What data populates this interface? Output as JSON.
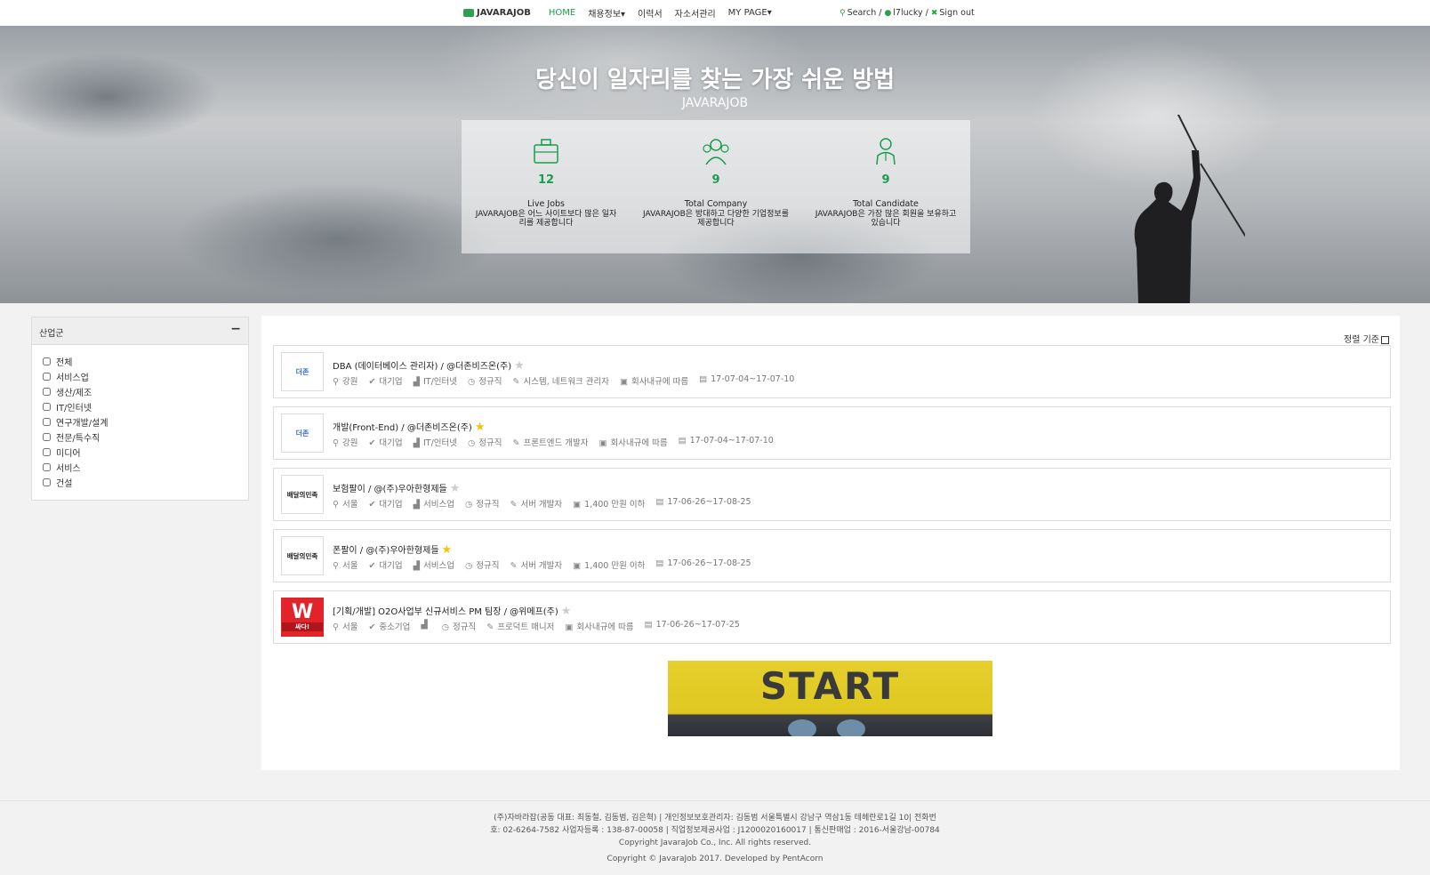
{
  "nav": {
    "logo": "JAVARAJOB",
    "items": [
      {
        "label": "HOME"
      },
      {
        "label": "채용정보▾"
      },
      {
        "label": "이력서"
      },
      {
        "label": "자소서관리"
      },
      {
        "label": "MY PAGE▾"
      }
    ],
    "search": "Search",
    "user": "l7lucky",
    "signout": "Sign out",
    "accent": "#1a9d4c"
  },
  "hero": {
    "title": "당신이 일자리를 찾는 가장 쉬운 방법",
    "subtitle": "JAVARAJOB",
    "stats": [
      {
        "value": "12",
        "label": "Live Jobs",
        "desc": "JAVARAJOB은 어느 사이트보다 많은 일자리를 제공합니다",
        "icon": "briefcase-icon"
      },
      {
        "value": "9",
        "label": "Total Company",
        "desc": "JAVARAJOB은 방대하고 다양한 기업정보를 제공합니다",
        "icon": "company-group-icon"
      },
      {
        "value": "9",
        "label": "Total Candidate",
        "desc": "JAVARAJOB은 가장 많은 회원을 보유하고 있습니다",
        "icon": "candidate-icon"
      }
    ]
  },
  "sidebar": {
    "title": "산업군",
    "toggle": "−",
    "filters": [
      "전체",
      "서비스업",
      "생산/제조",
      "IT/인터넷",
      "연구개발/설계",
      "전문/특수직",
      "미디어",
      "서비스",
      "건설"
    ]
  },
  "main": {
    "sort_label": "정렬 기준",
    "jobs": [
      {
        "title": "DBA (데이터베이스 관리자) / @더존비즈온(주)",
        "starred": false,
        "logo": "더존",
        "location": "강원",
        "size": "대기업",
        "industry": "IT/인터넷",
        "type": "정규직",
        "role": "시스템, 네트워크 관리자",
        "salary": "회사내규에 따름",
        "period": "17-07-04~17-07-10"
      },
      {
        "title": "개발(Front-End) / @더존비즈온(주)",
        "starred": true,
        "logo": "더존",
        "location": "강원",
        "size": "대기업",
        "industry": "IT/인터넷",
        "type": "정규직",
        "role": "프론트엔드 개발자",
        "salary": "회사내규에 따름",
        "period": "17-07-04~17-07-10"
      },
      {
        "title": "보험팔이 / @(주)우아한형제들",
        "starred": false,
        "logo": "배달의민족",
        "location": "서울",
        "size": "대기업",
        "industry": "서비스업",
        "type": "정규직",
        "role": "서버 개발자",
        "salary": "1,400 만원 이하",
        "period": "17-06-26~17-08-25"
      },
      {
        "title": "폰팔이 / @(주)우아한형제들",
        "starred": true,
        "logo": "배달의민족",
        "location": "서울",
        "size": "대기업",
        "industry": "서비스업",
        "type": "정규직",
        "role": "서버 개발자",
        "salary": "1,400 만원 이하",
        "period": "17-06-26~17-08-25"
      },
      {
        "title": "[기획/개발] O2O사업부 신규서비스 PM 팀장 / @위메프(주)",
        "starred": false,
        "logo": "W",
        "logo_sub": "싸다!",
        "location": "서울",
        "size": "중소기업",
        "industry": "",
        "type": "정규직",
        "role": "프로덕트 매니저",
        "salary": "회사내규에 따름",
        "period": "17-06-26~17-07-25"
      }
    ],
    "banner_text": "START"
  },
  "footer": {
    "line1": "(주)자바라잡(공동 대표: 최동철, 김동범, 김은혁) | 개인정보보호관리자: 김동범 서울특별시 강남구 역삼1동 테헤란로1길 10| 전화번",
    "line2": "호: 02-6264-7582 사업자등록 : 138-87-00058 | 직업정보제공사업 : J1200020160017 | 통신판매업 : 2016-서울강남-00784",
    "line3": "Copyright JavaraJob Co., Inc. All rights reserved.",
    "line4": "Copyright © JavaraJob 2017. Developed by PentAcorn"
  }
}
